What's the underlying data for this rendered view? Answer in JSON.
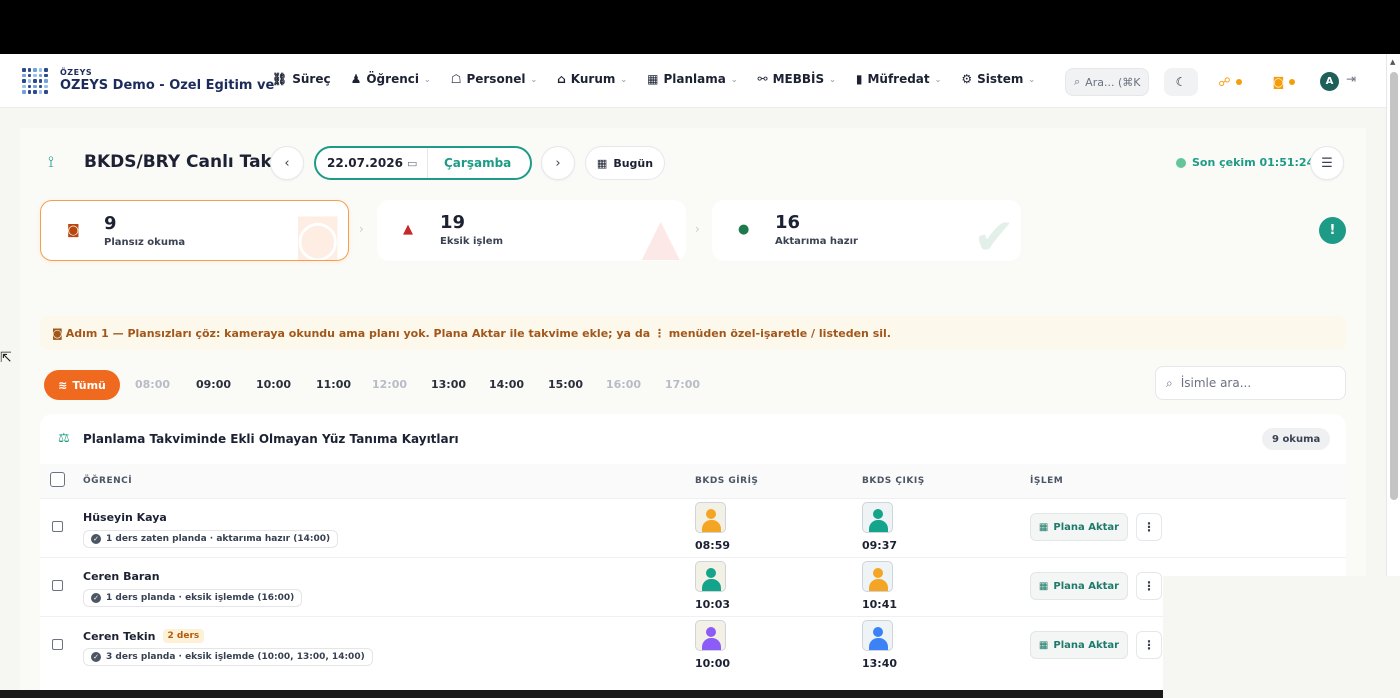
{
  "brand": {
    "small": "ÖZEYS",
    "title": "OZEYS Demo - Ozel Egitim ve"
  },
  "nav": {
    "items": [
      {
        "label": "Süreç",
        "icon": "process-icon",
        "glyph": "⛓",
        "dropdown": false
      },
      {
        "label": "Öğrenci",
        "icon": "student-icon",
        "glyph": "♟",
        "dropdown": true
      },
      {
        "label": "Personel",
        "icon": "staff-icon",
        "glyph": "☖",
        "dropdown": true
      },
      {
        "label": "Kurum",
        "icon": "institution-icon",
        "glyph": "⌂",
        "dropdown": true
      },
      {
        "label": "Planlama",
        "icon": "calendar-icon",
        "glyph": "▦",
        "dropdown": true
      },
      {
        "label": "MEBBİS",
        "icon": "link-icon",
        "glyph": "⚯",
        "dropdown": true
      },
      {
        "label": "Müfredat",
        "icon": "book-icon",
        "glyph": "▮",
        "dropdown": true
      },
      {
        "label": "Sistem",
        "icon": "gear-icon",
        "glyph": "⚙",
        "dropdown": true
      }
    ],
    "search_placeholder": "Ara... (⌘K",
    "avatar_initial": "A"
  },
  "page": {
    "title": "BKDS/BRY Canlı Takip",
    "date": "22.07.2026",
    "day": "Çarşamba",
    "today_label": "Bugün",
    "last_fetch": "Son çekim 01:51:24"
  },
  "stats": [
    {
      "value": "9",
      "label": "Plansız okuma",
      "icon": "camera-icon",
      "color": "#b8470e"
    },
    {
      "value": "19",
      "label": "Eksik işlem",
      "icon": "warning-icon",
      "color": "#c62828"
    },
    {
      "value": "16",
      "label": "Aktarıma hazır",
      "icon": "check-circle-icon",
      "color": "#1e7a4a"
    }
  ],
  "step_banner": "Adım 1 — Plansızları çöz: kameraya okundu ama planı yok. Plana Aktar ile takvime ekle; ya da ⋮ menüden özel-işaretle / listeden sil.",
  "filters": {
    "all_label": "Tümü",
    "hours": [
      {
        "label": "08:00",
        "active": false
      },
      {
        "label": "09:00",
        "active": true
      },
      {
        "label": "10:00",
        "active": true
      },
      {
        "label": "11:00",
        "active": true
      },
      {
        "label": "12:00",
        "active": false
      },
      {
        "label": "13:00",
        "active": true
      },
      {
        "label": "14:00",
        "active": true
      },
      {
        "label": "15:00",
        "active": true
      },
      {
        "label": "16:00",
        "active": false
      },
      {
        "label": "17:00",
        "active": false
      }
    ],
    "name_search_placeholder": "İsimle ara..."
  },
  "table": {
    "title": "Planlama Takviminde Ekli Olmayan Yüz Tanıma Kayıtları",
    "count_badge": "9 okuma",
    "columns": {
      "student": "ÖĞRENCİ",
      "entry": "BKDS GİRİŞ",
      "exit": "BKDS ÇIKIŞ",
      "action": "İŞLEM"
    },
    "action_label": "Plana Aktar",
    "rows": [
      {
        "name": "Hüseyin Kaya",
        "tag": "",
        "status": "1 ders zaten planda · aktarıma hazır (14:00)",
        "entry_time": "08:59",
        "exit_time": "09:37",
        "entry_color": "#f5a524",
        "exit_color": "#14a38b"
      },
      {
        "name": "Ceren Baran",
        "tag": "",
        "status": "1 ders planda · eksik işlemde (16:00)",
        "entry_time": "10:03",
        "exit_time": "10:41",
        "entry_color": "#14a38b",
        "exit_color": "#f5a524"
      },
      {
        "name": "Ceren Tekin",
        "tag": "2 ders",
        "status": "3 ders planda · eksik işlemde (10:00, 13:00, 14:00)",
        "entry_time": "10:00",
        "exit_time": "13:40",
        "entry_color": "#8b5cf6",
        "exit_color": "#3b82f6"
      }
    ]
  }
}
